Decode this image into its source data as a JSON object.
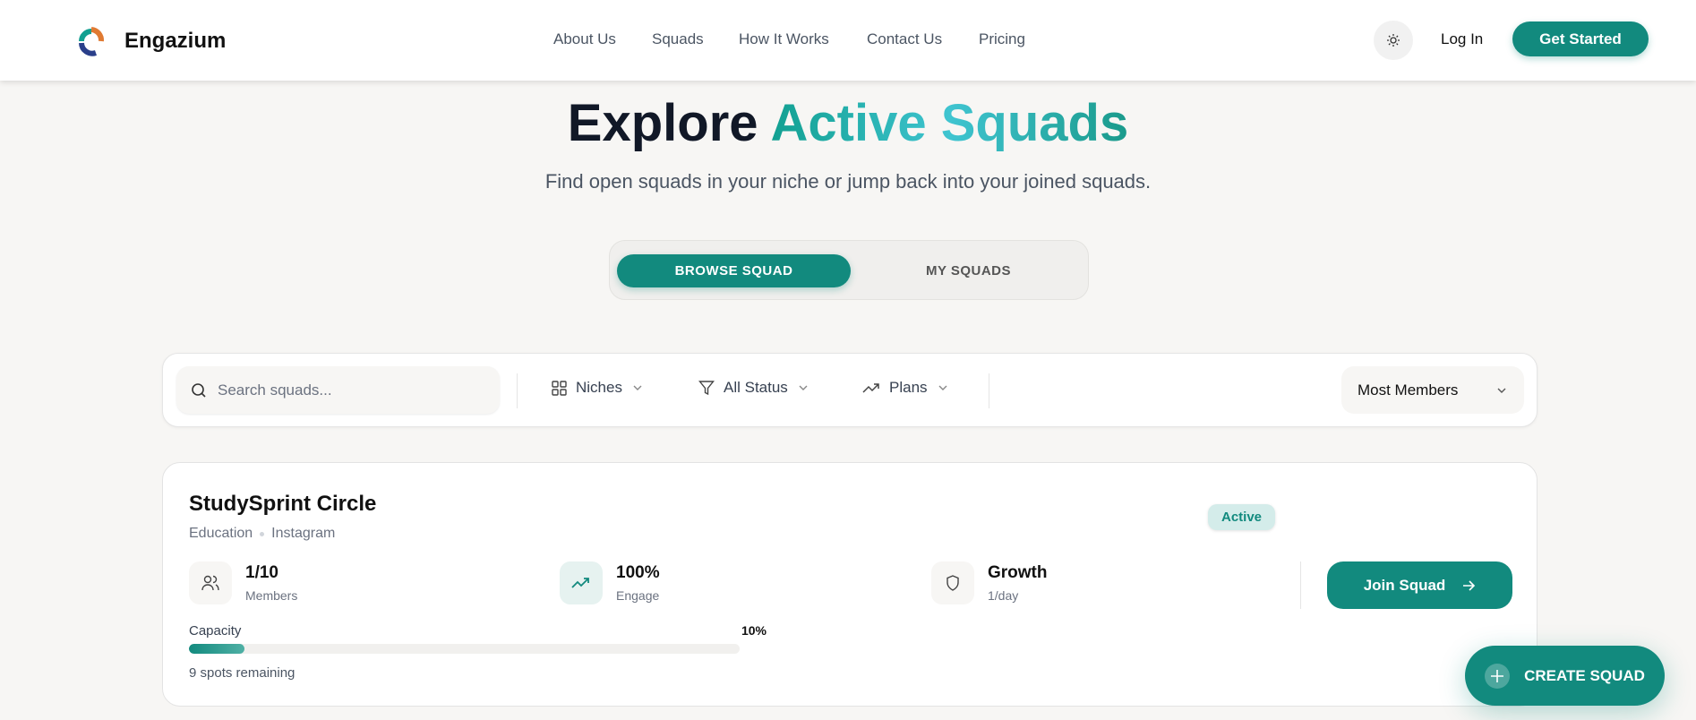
{
  "header": {
    "brand": "Engazium",
    "nav": [
      "About Us",
      "Squads",
      "How It Works",
      "Contact Us",
      "Pricing"
    ],
    "login": "Log In",
    "get_started": "Get Started"
  },
  "hero": {
    "title_dark": "Explore",
    "title_accent": "Active Squads",
    "subtitle": "Find open squads in your niche or jump back into your joined squads."
  },
  "tabs": {
    "browse": "BROWSE SQUAD",
    "mine": "MY SQUADS"
  },
  "filters": {
    "search_placeholder": "Search squads...",
    "niches": "Niches",
    "status": "All Status",
    "plans": "Plans",
    "sort": "Most Members"
  },
  "squad": {
    "name": "StudySprint Circle",
    "niche": "Education",
    "platform": "Instagram",
    "status": "Active",
    "members_value": "1/10",
    "members_label": "Members",
    "engage_value": "100%",
    "engage_label": "Engage",
    "plan_value": "Growth",
    "plan_label": "1/day",
    "capacity_label": "Capacity",
    "capacity_pct": "10%",
    "capacity_fraction": 0.1,
    "spots": "9 spots remaining",
    "join": "Join Squad"
  },
  "fab": {
    "label": "CREATE SQUAD"
  },
  "colors": {
    "accent": "#128a7e"
  }
}
